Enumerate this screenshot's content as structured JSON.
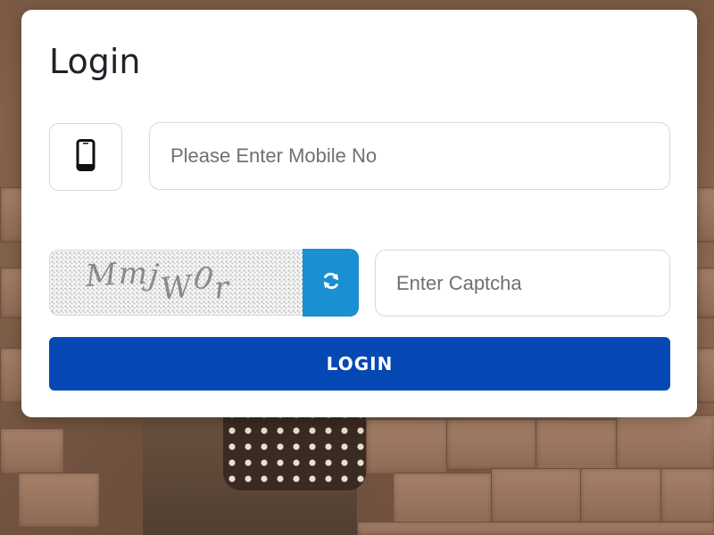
{
  "login": {
    "title": "Login",
    "mobile_icon": "mobile-phone-icon",
    "mobile_placeholder": "Please Enter Mobile No",
    "mobile_value": "",
    "captcha_text": "MmjW0r",
    "refresh_icon": "refresh-icon",
    "captcha_placeholder": "Enter Captcha",
    "captcha_value": "",
    "login_button": "LOGIN"
  },
  "colors": {
    "primary": "#0648b3",
    "refresh": "#1a8fd1",
    "border": "#d6d9de"
  }
}
